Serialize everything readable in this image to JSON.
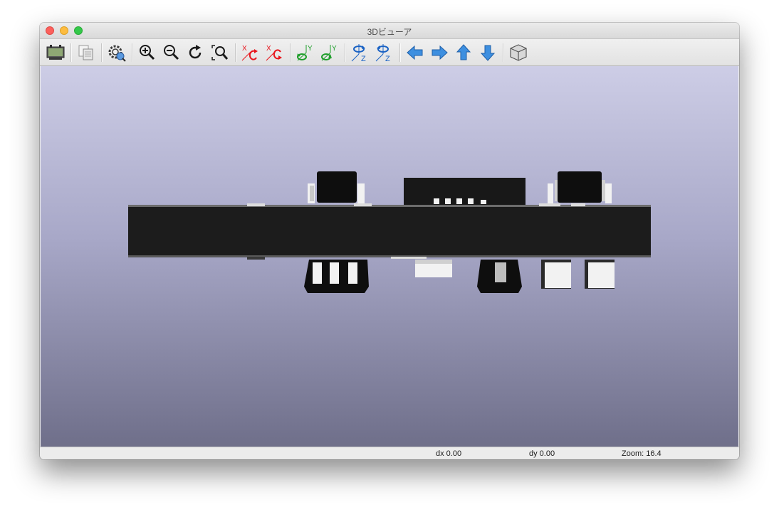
{
  "window": {
    "title": "3Dビューア"
  },
  "toolbar": {
    "buttons": [
      {
        "name": "export-image-icon"
      },
      {
        "name": "copy-to-clipboard-icon"
      },
      {
        "name": "3d-settings-icon"
      },
      {
        "name": "zoom-in-icon"
      },
      {
        "name": "zoom-out-icon"
      },
      {
        "name": "redraw-icon"
      },
      {
        "name": "zoom-fit-icon"
      },
      {
        "name": "rotate-x-cw-icon",
        "label": "X"
      },
      {
        "name": "rotate-x-ccw-icon",
        "label": "X"
      },
      {
        "name": "rotate-y-cw-icon",
        "label": "Y"
      },
      {
        "name": "rotate-y-ccw-icon",
        "label": "Y"
      },
      {
        "name": "rotate-z-cw-icon",
        "label": "Z"
      },
      {
        "name": "rotate-z-ccw-icon",
        "label": "Z"
      },
      {
        "name": "move-left-icon"
      },
      {
        "name": "move-right-icon"
      },
      {
        "name": "move-up-icon"
      },
      {
        "name": "move-down-icon"
      },
      {
        "name": "toggle-orthographic-icon"
      }
    ],
    "colors": {
      "x_axis": "#e8141b",
      "y_axis": "#1e9e2a",
      "z_axis": "#1a62c4",
      "arrow": "#3d8fe0"
    }
  },
  "viewport": {
    "background_top": "#cdcde6",
    "background_bottom": "#6f6f8a",
    "board_color": "#1c1c1c",
    "pad_color": "#f2f2f2"
  },
  "status": {
    "dx": "dx 0.00",
    "dy": "dy 0.00",
    "zoom": "Zoom: 16.4"
  }
}
